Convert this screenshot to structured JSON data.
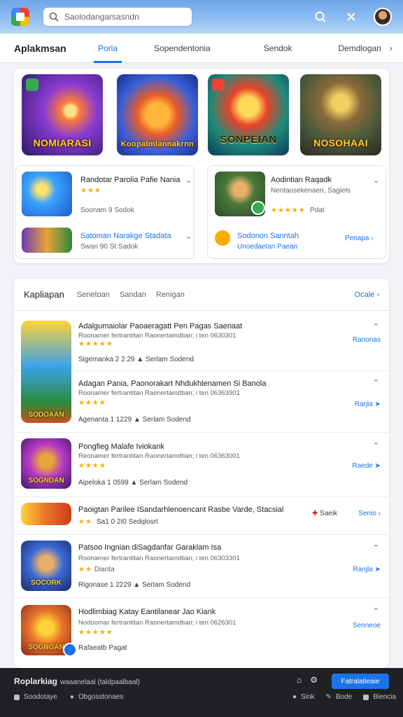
{
  "topbar": {
    "search_placeholder": "Saolodangarsasndn",
    "icons": [
      "app-logo",
      "search-icon",
      "close-icon",
      "avatar"
    ]
  },
  "nav": {
    "brand": "Aplakmsan",
    "tabs": [
      "Porla",
      "Sopendentonia",
      "Sendok",
      "Demdlogan"
    ],
    "active_tab": "Porla",
    "more_chevron": "›"
  },
  "featured": {
    "games": [
      {
        "label": "NOMIARASI"
      },
      {
        "label": "Koopalmlannakrnn"
      },
      {
        "label": "SONPEIAN"
      },
      {
        "label": "NOSOHAAI"
      }
    ],
    "rec_left": {
      "title": "Randotar Parolia Pafie Nania",
      "stars": "★★★",
      "meta": "Soonam 9 Sodok",
      "item2_title": "Satoman Narakge Stadata",
      "item2_meta": "Swan 90 St Sadok"
    },
    "rec_right": {
      "title": "Aodintian Raqadk",
      "subtitle": "Nentaosekenaen, Sagiels",
      "stars": "★★★★★",
      "rating_label": "Pdat",
      "item2_title": "Sodonon Sanntah",
      "item2_meta": "Unoedaetan Paean",
      "action": "Penapa ›"
    }
  },
  "apps": {
    "heading": "Kapliapan",
    "tabs": [
      "Senetoan",
      "Sandan",
      "Renigan"
    ],
    "more": "Ocale ›",
    "rows": [
      {
        "title": "Adalgumaiolar Paoaeragatt Pen Pagas Saenaat",
        "desc": "Roonamer fertrantitan Raonertamdtian; i ten 0630301",
        "stars": "★★★★★",
        "meta": "Sigemanka 2 2.29 ▲ Serlam Sodend",
        "action": "Ranonas",
        "icon_label": "SODOAAN"
      },
      {
        "title": "Adagan Pania, Paonorakart Nhdukhlenamen Si Banola",
        "desc": "Roonamer fertrantitan Raonertamdtian; i ten 06363901",
        "stars": "★★★★",
        "meta": "Agenanta 1 1229 ▲ Serlam Sodend",
        "action": "Rarjla ➤",
        "icon_label": ""
      },
      {
        "title": "Pongfieg Malafe Iviokank",
        "desc": "Reonamer fertrantitan Raonertamdtian; i ten 06363001",
        "stars": "★★★★",
        "meta": "Aipeloka 1 0599 ▲ Serlam Sodend",
        "action": "Raede ➤",
        "icon_label": "SOGNDAN"
      },
      {
        "title": "Paoigtan Parilee ISandarhlenoencant Rasbe Varde, Stacsial",
        "desc": "",
        "stars": "★★",
        "meta": "Sa1 0 2I0 Sedqlosrt",
        "action": "Senio ›",
        "icon_label": "",
        "extra": "Saeik"
      },
      {
        "title": "Patsoo Ingnian diSagdanfar Garaklam Isa",
        "desc": "Roonamer fertrantitan Raonertamdtian; i ten 06303301",
        "stars": "★★",
        "meta": "Rigonase 1 2229 ▲ Serlam Sodend",
        "action": "Ranjla ➤",
        "extra_stars": "Dianta",
        "icon_label": "SOCORK"
      },
      {
        "title": "Hodlimbiag Katay Eantilanear Jao Kiank",
        "desc": "Nodoomar fertrantitan Raonertamdtian; i ten 0626301",
        "stars": "★★★★★",
        "meta": "Rafaeatb Pagat",
        "action": "Senneoe",
        "icon_label": "SOGNGAN"
      }
    ]
  },
  "bottombar": {
    "title": "Roplarkiag",
    "subtitle": "waaanelaal (taldpaalbaal)",
    "button": "Fatralatieaie",
    "left_items": [
      "Soodotaye",
      "Obgosstonaes"
    ],
    "right_items": [
      "Sink",
      "Bode",
      "Biencia"
    ]
  }
}
